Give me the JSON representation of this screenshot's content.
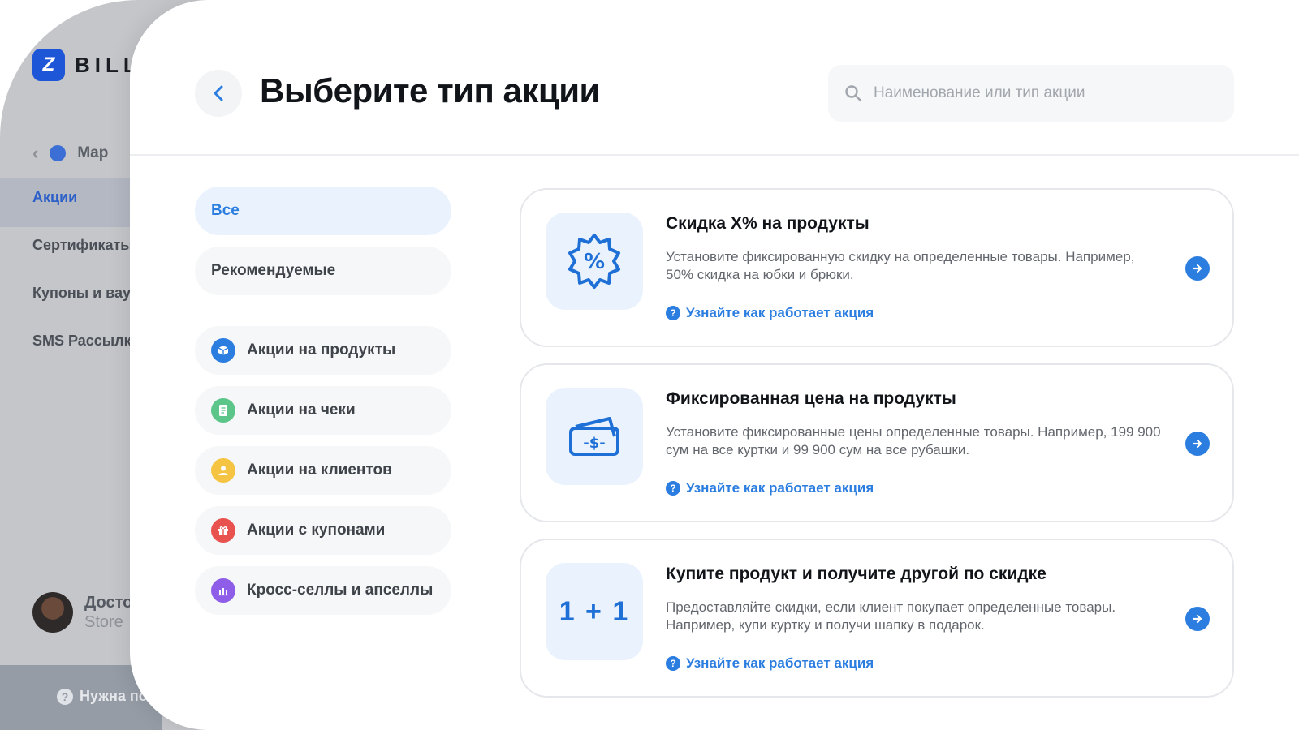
{
  "background_app": {
    "logo_letter": "Z",
    "logo_text": "BILL",
    "breadcrumb": "Map",
    "nav": [
      {
        "label": "Акции",
        "active": true
      },
      {
        "label": "Сертификаты",
        "active": false
      },
      {
        "label": "Купоны и ваучеры",
        "active": false
      },
      {
        "label": "SMS Рассылки",
        "active": false
      }
    ],
    "user": {
      "name": "Досто",
      "store": "Store"
    },
    "help": "Нужна помощь?"
  },
  "header": {
    "title": "Выберите тип акции",
    "back_icon": "chevron-left-icon",
    "search": {
      "placeholder": "Наименование или тип акции",
      "value": "",
      "icon": "search-icon"
    }
  },
  "filters": [
    {
      "label": "Все",
      "active": true
    },
    {
      "label": "Рекомендуемые",
      "active": false
    }
  ],
  "categories": [
    {
      "label": "Акции на продукты",
      "icon": "box-icon",
      "color": "#2b7de0"
    },
    {
      "label": "Акции на чеки",
      "icon": "receipt-icon",
      "color": "#5cc58a"
    },
    {
      "label": "Акции на клиентов",
      "icon": "user-icon",
      "color": "#f5c443"
    },
    {
      "label": "Акции с купонами",
      "icon": "gift-icon",
      "color": "#e8524f"
    },
    {
      "label": "Кросс-селлы и апселлы",
      "icon": "chart-icon",
      "color": "#8f5ee8"
    }
  ],
  "cards": [
    {
      "title": "Скидка X% на продукты",
      "description": "Установите фиксированную скидку на определенные товары. Например, 50% скидка на юбки и брюки.",
      "link": "Узнайте как работает акция",
      "icon": "percent-badge-icon"
    },
    {
      "title": "Фиксированная цена на продукты",
      "description": "Установите фиксированные цены определенные товары. Например, 199 900 сум на все куртки и 99 900 сум на все рубашки.",
      "link": "Узнайте как работает акция",
      "icon": "money-icon"
    },
    {
      "title": "Купите продукт и получите другой по скидке",
      "description": "Предоставляйте скидки, если клиент покупает определенные товары. Например, купи куртку и получи шапку в подарок.",
      "link": "Узнайте как работает акция",
      "icon": "one-plus-one-icon",
      "icon_text": "1 + 1"
    }
  ],
  "colors": {
    "accent": "#2b7de0",
    "brand": "#1d56d6",
    "icon_bg": "#eaf3fd"
  }
}
